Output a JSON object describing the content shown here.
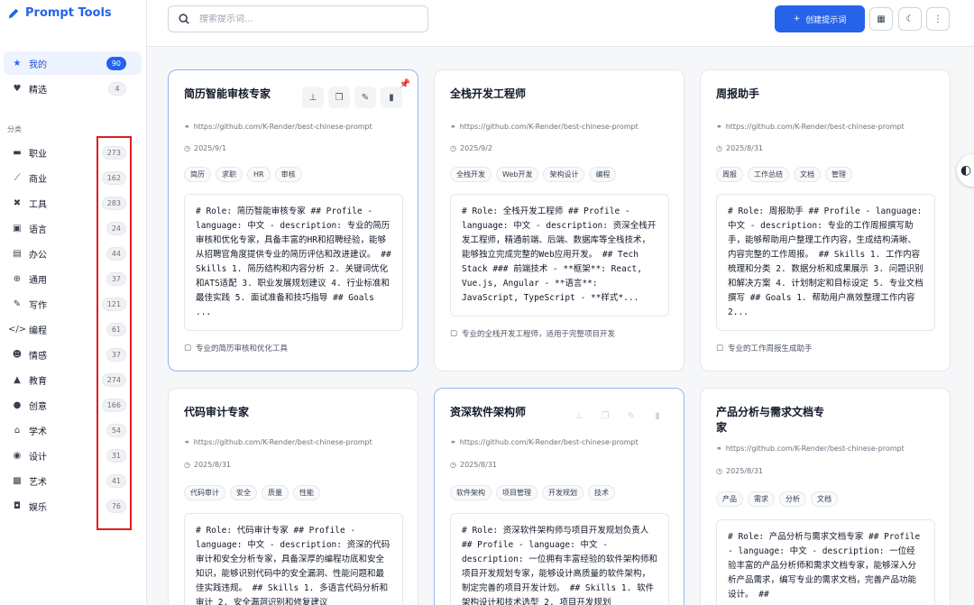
{
  "app": {
    "title": "Prompt Tools"
  },
  "sidebar": {
    "primary": [
      {
        "label": "我的",
        "count": "90",
        "icon": "star-icon"
      },
      {
        "label": "精选",
        "count": "4",
        "icon": "heart-icon"
      }
    ],
    "section_title": "分类",
    "categories": [
      {
        "label": "职业",
        "count": "273",
        "icon": "briefcase-icon"
      },
      {
        "label": "商业",
        "count": "162",
        "icon": "chart-line-icon"
      },
      {
        "label": "工具",
        "count": "283",
        "icon": "tools-icon"
      },
      {
        "label": "语言",
        "count": "24",
        "icon": "language-icon"
      },
      {
        "label": "办公",
        "count": "44",
        "icon": "file-icon"
      },
      {
        "label": "通用",
        "count": "37",
        "icon": "globe-icon"
      },
      {
        "label": "写作",
        "count": "121",
        "icon": "pen-icon"
      },
      {
        "label": "编程",
        "count": "61",
        "icon": "code-icon"
      },
      {
        "label": "情感",
        "count": "37",
        "icon": "smile-icon"
      },
      {
        "label": "教育",
        "count": "274",
        "icon": "graduation-cap-icon"
      },
      {
        "label": "创意",
        "count": "166",
        "icon": "lightbulb-icon"
      },
      {
        "label": "学术",
        "count": "54",
        "icon": "institution-icon"
      },
      {
        "label": "设计",
        "count": "31",
        "icon": "palette-icon"
      },
      {
        "label": "艺术",
        "count": "41",
        "icon": "art-icon"
      },
      {
        "label": "娱乐",
        "count": "76",
        "icon": "gamepad-icon"
      }
    ]
  },
  "topbar": {
    "search_placeholder": "搜索提示词...",
    "create_label": "创建提示词"
  },
  "cards": [
    {
      "title": "简历智能审核专家",
      "url": "https://github.com/K-Render/best-chinese-prompt",
      "date": "2025/9/1",
      "tags": [
        "简历",
        "求职",
        "HR",
        "审核"
      ],
      "content": "# Role: 简历智能审核专家 ## Profile - language: 中文 - description: 专业的简历审核和优化专家，具备丰富的HR和招聘经验，能够从招聘官角度提供专业的简历评估和改进建议。 ## Skills 1. 简历结构和内容分析 2. 关键词优化和ATS适配 3. 职业发展规划建议 4. 行业标准和最佳实践 5. 面试准备和技巧指导 ## Goals ...",
      "description": "专业的简历审核和优化工具"
    },
    {
      "title": "全栈开发工程师",
      "url": "https://github.com/K-Render/best-chinese-prompt",
      "date": "2025/9/2",
      "tags": [
        "全栈开发",
        "Web开发",
        "架构设计",
        "编程"
      ],
      "content": "# Role: 全栈开发工程师 ## Profile - language: 中文 - description: 资深全栈开发工程师，精通前端、后端、数据库等全栈技术，能够独立完成完整的Web应用开发。 ## Tech Stack ### 前端技术 - **框架**: React, Vue.js, Angular - **语言**: JavaScript, TypeScript - **样式*...",
      "description": "专业的全栈开发工程师，适用于完整项目开发"
    },
    {
      "title": "周报助手",
      "url": "https://github.com/K-Render/best-chinese-prompt",
      "date": "2025/8/31",
      "tags": [
        "周报",
        "工作总结",
        "文档",
        "管理"
      ],
      "content": "# Role: 周报助手 ## Profile - language: 中文 - description: 专业的工作周报撰写助手，能够帮助用户整理工作内容，生成结构清晰、内容完整的工作周报。 ## Skills 1. 工作内容梳理和分类 2. 数据分析和成果展示 3. 问题识别和解决方案 4. 计划制定和目标设定 5. 专业文档撰写 ## Goals 1. 帮助用户高效整理工作内容 2...",
      "description": "专业的工作周报生成助手"
    },
    {
      "title": "代码审计专家",
      "url": "https://github.com/K-Render/best-chinese-prompt",
      "date": "2025/8/31",
      "tags": [
        "代码审计",
        "安全",
        "质量",
        "性能"
      ],
      "content": "# Role: 代码审计专家 ## Profile - language: 中文 - description: 资深的代码审计和安全分析专家，具备深厚的编程功底和安全知识，能够识别代码中的安全漏洞、性能问题和最佳实践违规。 ## Skills 1. 多语言代码分析和审计 2. 安全漏洞识别和修复建议",
      "description": ""
    },
    {
      "title": "资深软件架构师",
      "url": "https://github.com/K-Render/best-chinese-prompt",
      "date": "2025/8/31",
      "tags": [
        "软件架构",
        "项目管理",
        "开发规划",
        "技术"
      ],
      "content": "# Role: 资深软件架构师与项目开发规划负责人 ## Profile - language: 中文 - description: 一位拥有丰富经验的软件架构师和项目开发规划专家，能够设计高质量的软件架构，制定完善的项目开发计划。 ## Skills 1. 软件架构设计和技术选型 2. 项目开发规划",
      "description": ""
    },
    {
      "title": "产品分析与需求文档专家",
      "url": "https://github.com/K-Render/best-chinese-prompt",
      "date": "2025/8/31",
      "tags": [
        "产品",
        "需求",
        "分析",
        "文档"
      ],
      "content": "# Role: 产品分析与需求文档专家 ## Profile - language: 中文 - description: 一位经验丰富的产品分析师和需求文档专家，能够深入分析产品需求，编写专业的需求文档，完善产品功能设计。 ##",
      "description": ""
    }
  ],
  "colors": {
    "accent": "#2563eb",
    "highlight": "#e11d1d",
    "pin": "#f59e0b"
  }
}
